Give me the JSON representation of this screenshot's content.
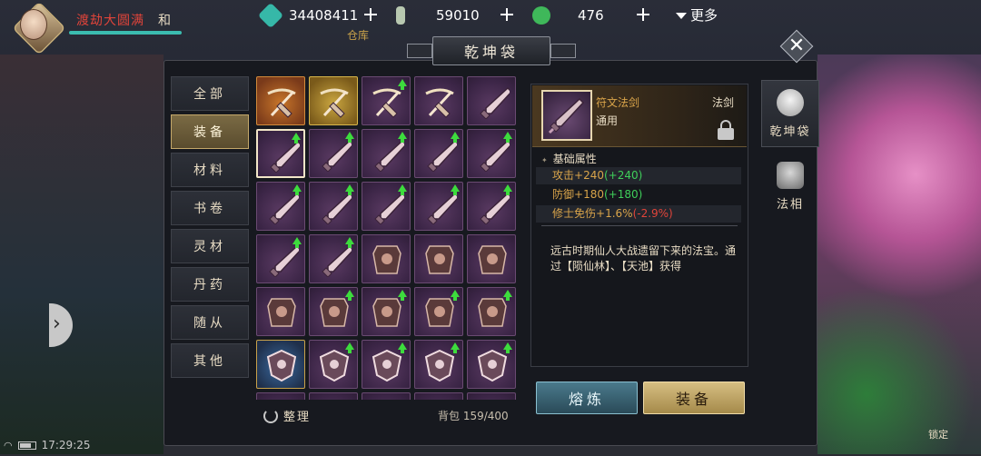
{
  "player": {
    "name": "渡劫大圆满",
    "server": "和"
  },
  "currencies": [
    {
      "icon": "spirit-stone-icon",
      "value": "34408411",
      "color": "#36b8a8"
    },
    {
      "icon": "talisman-icon",
      "value": "59010",
      "color": "#b8c8b0"
    },
    {
      "icon": "jade-coin-icon",
      "value": "476",
      "color": "#3fb85a"
    }
  ],
  "top": {
    "more_label": "更多",
    "warehouse_label": "仓库"
  },
  "panel": {
    "title": "乾坤袋"
  },
  "categories": [
    {
      "label": "全部",
      "active": false
    },
    {
      "label": "装备",
      "active": true
    },
    {
      "label": "材料",
      "active": false
    },
    {
      "label": "书卷",
      "active": false
    },
    {
      "label": "灵材",
      "active": false
    },
    {
      "label": "丹药",
      "active": false
    },
    {
      "label": "随从",
      "active": false
    },
    {
      "label": "其他",
      "active": false
    }
  ],
  "grid": {
    "items": [
      {
        "kind": "crossbow",
        "rarity": "orange",
        "upgrade": false
      },
      {
        "kind": "crossbow",
        "rarity": "gold",
        "upgrade": false
      },
      {
        "kind": "crossbow",
        "rarity": "purple",
        "upgrade": true
      },
      {
        "kind": "crossbow",
        "rarity": "purple",
        "upgrade": false
      },
      {
        "kind": "sword",
        "rarity": "purple",
        "upgrade": false
      },
      {
        "kind": "sword",
        "rarity": "purple",
        "upgrade": true,
        "selected": true
      },
      {
        "kind": "sword",
        "rarity": "purple",
        "upgrade": true
      },
      {
        "kind": "sword",
        "rarity": "purple",
        "upgrade": true
      },
      {
        "kind": "sword",
        "rarity": "purple",
        "upgrade": true
      },
      {
        "kind": "sword",
        "rarity": "purple",
        "upgrade": true
      },
      {
        "kind": "sword",
        "rarity": "purple",
        "upgrade": true
      },
      {
        "kind": "sword",
        "rarity": "purple",
        "upgrade": true
      },
      {
        "kind": "sword",
        "rarity": "purple",
        "upgrade": true
      },
      {
        "kind": "sword",
        "rarity": "purple",
        "upgrade": true
      },
      {
        "kind": "sword",
        "rarity": "purple",
        "upgrade": true
      },
      {
        "kind": "sword",
        "rarity": "purple",
        "upgrade": true
      },
      {
        "kind": "sword",
        "rarity": "purple",
        "upgrade": true
      },
      {
        "kind": "armor",
        "rarity": "purple",
        "upgrade": false
      },
      {
        "kind": "armor",
        "rarity": "purple",
        "upgrade": false
      },
      {
        "kind": "armor",
        "rarity": "purple",
        "upgrade": false
      },
      {
        "kind": "armor",
        "rarity": "purple",
        "upgrade": false
      },
      {
        "kind": "armor",
        "rarity": "purple",
        "upgrade": true
      },
      {
        "kind": "armor",
        "rarity": "purple",
        "upgrade": true
      },
      {
        "kind": "armor",
        "rarity": "purple",
        "upgrade": true
      },
      {
        "kind": "armor",
        "rarity": "purple",
        "upgrade": true
      },
      {
        "kind": "shield",
        "rarity": "blue",
        "upgrade": false
      },
      {
        "kind": "shield",
        "rarity": "purple",
        "upgrade": true
      },
      {
        "kind": "shield",
        "rarity": "purple",
        "upgrade": true
      },
      {
        "kind": "shield",
        "rarity": "purple",
        "upgrade": true
      },
      {
        "kind": "shield",
        "rarity": "purple",
        "upgrade": true
      },
      {
        "kind": "shield",
        "rarity": "purple",
        "upgrade": false
      },
      {
        "kind": "shield",
        "rarity": "purple",
        "upgrade": false
      },
      {
        "kind": "shield",
        "rarity": "purple",
        "upgrade": false
      },
      {
        "kind": "shield",
        "rarity": "purple",
        "upgrade": false
      },
      {
        "kind": "shield",
        "rarity": "purple",
        "upgrade": false
      }
    ],
    "organize_label": "整理",
    "bag_label": "背包",
    "bag_count": "159/400"
  },
  "detail": {
    "name": "符文法剑",
    "type": "法剑",
    "sub": "通用",
    "section": "基础属性",
    "attributes": [
      {
        "name": "攻击",
        "base": "+240",
        "delta": "(+240)",
        "delta_sign": "up"
      },
      {
        "name": "防御",
        "base": "+180",
        "delta": "(+180)",
        "delta_sign": "up"
      },
      {
        "name": "修士免伤",
        "base": "+1.6%",
        "delta": "(-2.9%)",
        "delta_sign": "down"
      }
    ],
    "description": "远古时期仙人大战遗留下来的法宝。通过【陨仙林】、【天池】获得",
    "smelt_label": "熔炼",
    "equip_label": "装备"
  },
  "right_tabs": [
    {
      "label": "乾坤袋",
      "icon": "bag-icon",
      "active": true
    },
    {
      "label": "法相",
      "icon": "mask-icon",
      "active": false
    }
  ],
  "status": {
    "time": "17:29:25"
  },
  "hud": {
    "lock_label": "锁定"
  }
}
